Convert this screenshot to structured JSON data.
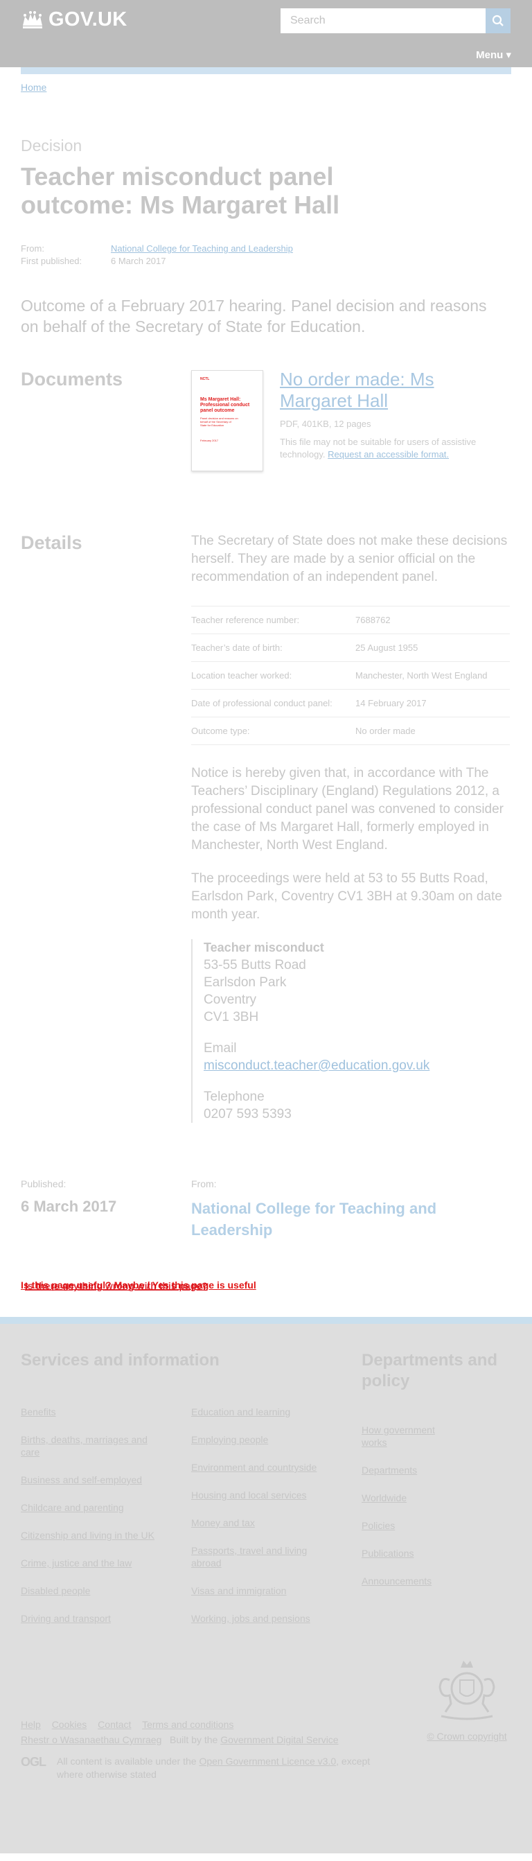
{
  "header": {
    "logo_text": "GOV.UK",
    "search_placeholder": "Search",
    "menu_label": "Menu ▾"
  },
  "breadcrumb": {
    "home": "Home"
  },
  "title": {
    "caption": "Decision",
    "heading": "Teacher misconduct panel outcome: Ms Margaret Hall"
  },
  "metadata": {
    "from_label": "From:",
    "from_value": "National College for Teaching and Leadership",
    "published_label": "First published:",
    "published_value": "6 March 2017"
  },
  "lede": "Outcome of a February 2017 hearing. Panel decision and reasons on behalf of the Secretary of State for Education.",
  "documents": {
    "heading": "Documents",
    "thumbnail_lines": [
      "Ms Margaret Hall:",
      "Professional conduct",
      "panel outcome",
      "Panel decision and reasons on",
      "behalf of the Secretary of",
      "State for Education",
      "February 2017"
    ],
    "title": "No order made: Ms Margaret Hall",
    "meta": "PDF, 401KB, 12 pages",
    "note": "This file may not be suitable for users of assistive technology.",
    "note_link": "Request an accessible format."
  },
  "details": {
    "heading": "Details",
    "intro": "The Secretary of State does not make these decisions herself. They are made by a senior official on the recommendation of an independent panel.",
    "facts": [
      {
        "key": "Teacher reference number:",
        "value": "7688762"
      },
      {
        "key": "Teacher’s date of birth:",
        "value": "25 August 1955"
      },
      {
        "key": "Location teacher worked:",
        "value": "Manchester, North West England"
      },
      {
        "key": "Date of professional conduct panel:",
        "value": "14 February 2017"
      },
      {
        "key": "Outcome type:",
        "value": "No order made"
      }
    ],
    "para1": "Notice is hereby given that, in accordance with The Teachers’ Disciplinary (England) Regulations 2012, a professional conduct panel was convened to consider the case of Ms Margaret Hall, formerly employed in Manchester, North West England.",
    "para2": "The proceedings were held at 53 to 55 Butts Road, Earlsdon Park, Coventry CV1 3BH at 9.30am on date month year.",
    "address": {
      "org": "Teacher misconduct",
      "line1": "53-55 Butts Road",
      "line2": "Earlsdon Park",
      "line3": "Coventry",
      "line4": "CV1 3BH",
      "email_label": "Email",
      "email": "misconduct.teacher@education.gov.uk",
      "phone_label": "Telephone",
      "phone": "0207 593 5393"
    }
  },
  "published": {
    "published_label": "Published:",
    "published_date": "6 March 2017",
    "from_label": "From:",
    "from_org": "National College for Teaching and Leadership"
  },
  "feedback": {
    "link_a": "Is this page useful? Maybe / Yes this page is useful",
    "link_b": "Is there anything wrong with this page?"
  },
  "footer": {
    "services_heading": "Services and information",
    "departments_heading": "Departments and policy",
    "services_col1": [
      "Benefits",
      "Births, deaths, marriages and care",
      "Business and self-employed",
      "Childcare and parenting",
      "Citizenship and living in the UK",
      "Crime, justice and the law",
      "Disabled people",
      "Driving and transport"
    ],
    "services_col2": [
      "Education and learning",
      "Employing people",
      "Environment and countryside",
      "Housing and local services",
      "Money and tax",
      "Passports, travel and living abroad",
      "Visas and immigration",
      "Working, jobs and pensions"
    ],
    "departments": [
      "How government works",
      "Departments",
      "Worldwide",
      "Policies",
      "Publications",
      "Announcements"
    ],
    "help_links": [
      "Help",
      "Cookies",
      "Contact",
      "Terms and conditions"
    ],
    "welsh": "Rhestr o Wasanaethau Cymraeg",
    "built_by": "Built by the",
    "built_by_link": "Government Digital Service",
    "ogl": "OGL",
    "licence_prefix": "All content is available under the",
    "licence_link": "Open Government Licence v3.0",
    "licence_suffix": ", except where otherwise stated",
    "copyright": "© Crown copyright"
  },
  "colors": {
    "header_bg": "#bdbdbd",
    "accent_bar": "#cfe2f1",
    "link": "#9fc1dd",
    "feedback_link": "#e01818",
    "footer_bg": "#dedede"
  },
  "icons": [
    "crown-icon",
    "search-icon",
    "chevron-down-icon",
    "royal-crest-icon"
  ]
}
